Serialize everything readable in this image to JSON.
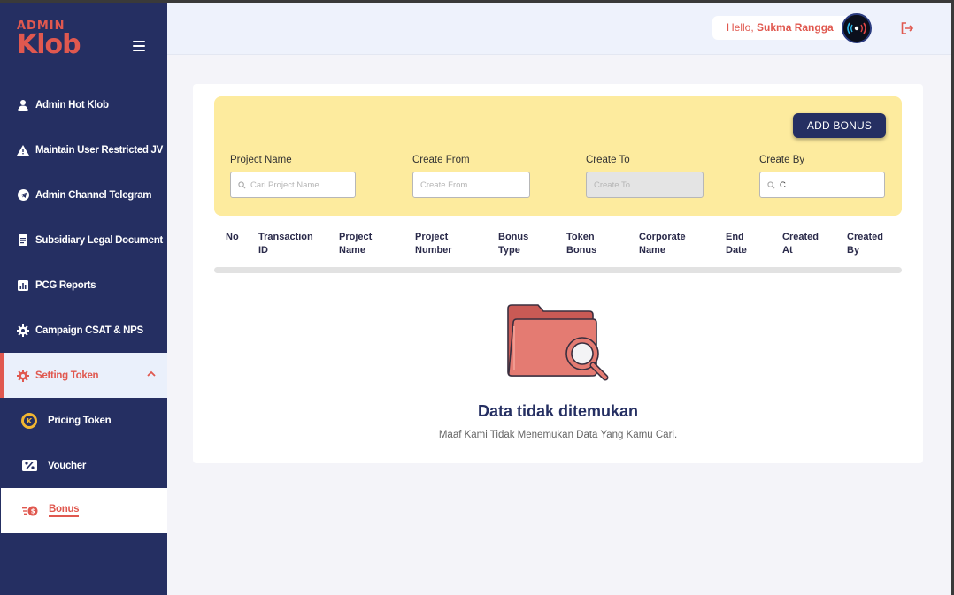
{
  "app": {
    "logo_small": "ADMIN",
    "logo_big": "Klob"
  },
  "sidebar": {
    "items": [
      {
        "label": "Admin Hot Klob",
        "icon": "user-badge-icon"
      },
      {
        "label": "Maintain User Restricted JV",
        "icon": "warning-icon"
      },
      {
        "label": "Admin Channel Telegram",
        "icon": "telegram-icon"
      },
      {
        "label": "Subsidiary Legal Document",
        "icon": "document-icon"
      },
      {
        "label": "PCG Reports",
        "icon": "bar-chart-icon"
      },
      {
        "label": "Campaign CSAT & NPS",
        "icon": "gear-icon"
      },
      {
        "label": "Setting Token",
        "icon": "gear-icon"
      }
    ],
    "sub_items": [
      {
        "label": "Pricing Token",
        "icon": "token-coin-icon"
      },
      {
        "label": "Voucher",
        "icon": "voucher-icon"
      },
      {
        "label": "Bonus",
        "icon": "bonus-icon"
      }
    ]
  },
  "header": {
    "greeting_prefix": "Hello, ",
    "user_name": "Sukma Rangga"
  },
  "filter": {
    "add_button": "ADD BONUS",
    "fields": [
      {
        "label": "Project Name",
        "placeholder": "Cari Project Name",
        "value": ""
      },
      {
        "label": "Create From",
        "placeholder": "Create From",
        "value": ""
      },
      {
        "label": "Create To",
        "placeholder": "Create To",
        "value": ""
      },
      {
        "label": "Create By",
        "placeholder": "",
        "value": "C"
      }
    ]
  },
  "table": {
    "columns": [
      [
        "No",
        ""
      ],
      [
        "Transaction",
        "ID"
      ],
      [
        "Project",
        "Name"
      ],
      [
        "Project",
        "Number"
      ],
      [
        "Bonus",
        "Type"
      ],
      [
        "Token",
        "Bonus"
      ],
      [
        "Corporate",
        "Name"
      ],
      [
        "End",
        "Date"
      ],
      [
        "Created",
        "At"
      ],
      [
        "Created",
        "By"
      ]
    ]
  },
  "empty_state": {
    "title": "Data tidak ditemukan",
    "subtitle": "Maaf Kami Tidak Menemukan Data Yang Kamu Cari."
  },
  "colors": {
    "sidebar_bg": "#252f62",
    "accent": "#e0584f",
    "filter_bg": "#fdeb9e",
    "button_bg": "#252f62"
  }
}
